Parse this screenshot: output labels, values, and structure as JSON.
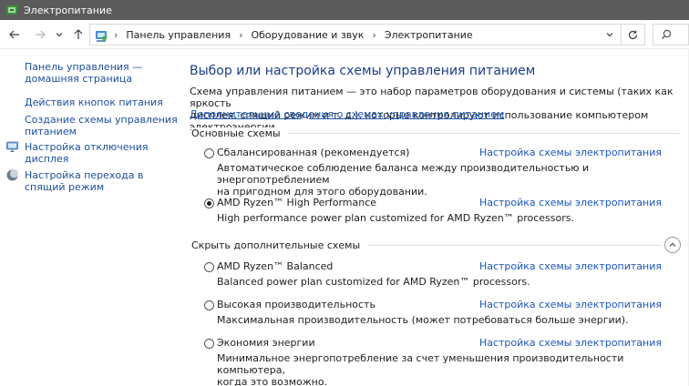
{
  "window": {
    "title": "Электропитание",
    "accent": "#1a56b8"
  },
  "address": {
    "crumbs": [
      "Панель управления",
      "Оборудование и звук",
      "Электропитание"
    ]
  },
  "sidebar": {
    "home": [
      "Панель управления —",
      "домашняя страница"
    ],
    "power_buttons": [
      "Действия кнопок питания"
    ],
    "create_plan": [
      "Создание схемы управления",
      "питанием"
    ],
    "display_off": [
      "Настройка отключения",
      "дисплея"
    ],
    "sleep": [
      "Настройка перехода в",
      "спящий режим"
    ]
  },
  "main": {
    "heading": "Выбор или настройка схемы управления питанием",
    "description": [
      "Схема управления питанием — это набор параметров оборудования и системы (таких как яркость",
      "дисплея, спящий режим и т. д.), которые контролируют использование компьютером электроэнергии."
    ],
    "more_link": "Дополнительные сведения о схемах управления питанием",
    "primary_group": "Основные схемы",
    "hidden_group": "Скрыть дополнительные схемы",
    "plan_link_label": "Настройка схемы электропитания",
    "plans": [
      {
        "name": "Сбалансированная (рекомендуется)",
        "selected": false,
        "description": [
          "Автоматическое соблюдение баланса между производительностью и энергопотреблением",
          "на пригодном для этого оборудовании."
        ]
      },
      {
        "name": "AMD Ryzen™ High Performance",
        "selected": true,
        "description": [
          "High performance power plan customized for AMD Ryzen™ processors."
        ]
      },
      {
        "name": "AMD Ryzen™ Balanced",
        "selected": false,
        "description": [
          "Balanced power plan customized for AMD Ryzen™ processors."
        ]
      },
      {
        "name": "Высокая производительность",
        "selected": false,
        "description": [
          "Максимальная производительность (может потребоваться больше энергии)."
        ]
      },
      {
        "name": "Экономия энергии",
        "selected": false,
        "description": [
          "Минимальное энергопотребление за счет уменьшения производительности компьютера,",
          "когда это возможно."
        ]
      }
    ]
  }
}
